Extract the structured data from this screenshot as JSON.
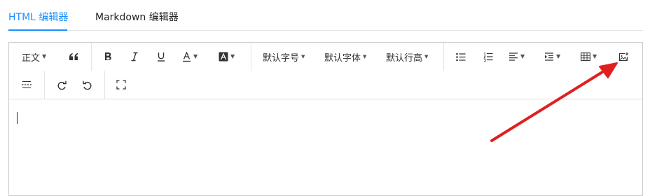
{
  "tabs": [
    {
      "label": "HTML 编辑器",
      "active": true
    },
    {
      "label": "Markdown 编辑器",
      "active": false
    }
  ],
  "toolbar": {
    "heading": "正文",
    "font_size": "默认字号",
    "font_family": "默认字体",
    "line_height": "默认行高"
  },
  "icons": {
    "quote": "quote-icon",
    "bold": "bold-icon",
    "italic": "italic-icon",
    "underline": "underline-icon",
    "font_color": "font-color-icon",
    "bg_color": "background-color-icon",
    "bullet_list": "bullet-list-icon",
    "ordered_list": "ordered-list-icon",
    "align": "align-icon",
    "indent": "indent-icon",
    "table": "table-icon",
    "image": "image-upload-icon",
    "divider": "divider-icon",
    "redo": "redo-icon",
    "undo": "undo-icon",
    "fullscreen": "fullscreen-icon"
  },
  "colors": {
    "accent": "#1890ff",
    "annotation_arrow": "#e02020"
  }
}
